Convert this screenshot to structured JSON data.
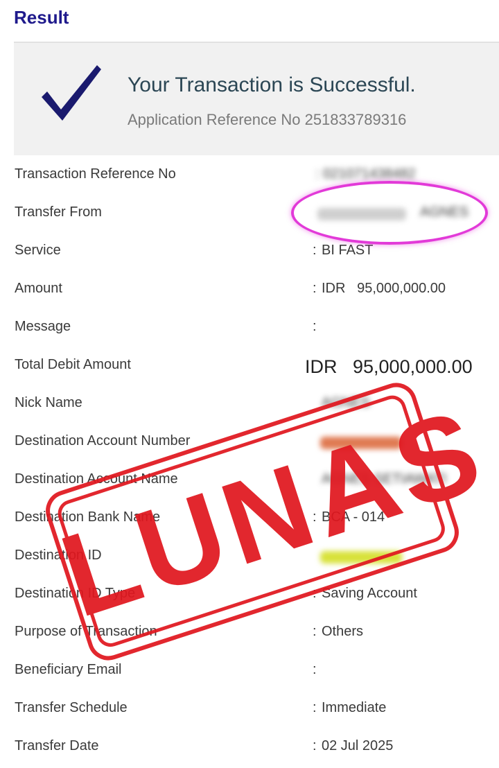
{
  "header": {
    "title": "Result"
  },
  "banner": {
    "status": "Your Transaction is Successful.",
    "reference": "Application Reference No 251833789316"
  },
  "details": {
    "transaction_reference": {
      "label": "Transaction Reference No",
      "value": ": 021071438482"
    },
    "transfer_from": {
      "label": "Transfer From",
      "value": "AGNES"
    },
    "service": {
      "label": "Service",
      "value": "BI FAST"
    },
    "amount": {
      "label": "Amount",
      "value": "IDR   95,000,000.00"
    },
    "message": {
      "label": "Message",
      "value": ""
    },
    "total_debit": {
      "label": "Total Debit Amount",
      "value": "IDR   95,000,000.00"
    },
    "nick_name": {
      "label": "Nick Name",
      "value": "AGNES"
    },
    "dest_account_number": {
      "label": "Destination Account Number"
    },
    "dest_account_name": {
      "label": "Destination Account Name",
      "value": "AGNES SETIAWATI"
    },
    "dest_bank_name": {
      "label": "Destination Bank Name",
      "value": "BCA - 014"
    },
    "dest_id": {
      "label": "Destination ID"
    },
    "dest_id_type": {
      "label": "Destination ID Type",
      "value": "Saving Account"
    },
    "purpose": {
      "label": "Purpose of Transaction",
      "value": "Others"
    },
    "beneficiary_email": {
      "label": "Beneficiary Email",
      "value": ""
    },
    "schedule": {
      "label": "Transfer Schedule",
      "value": "Immediate"
    },
    "date": {
      "label": "Transfer Date",
      "value": "02 Jul 2025"
    }
  },
  "stamp": {
    "text": "LUNAS",
    "color": "#e0171f"
  },
  "colors": {
    "title": "#1f1a8c",
    "highlight": "#e23ad8",
    "check": "#1a1a6e"
  }
}
